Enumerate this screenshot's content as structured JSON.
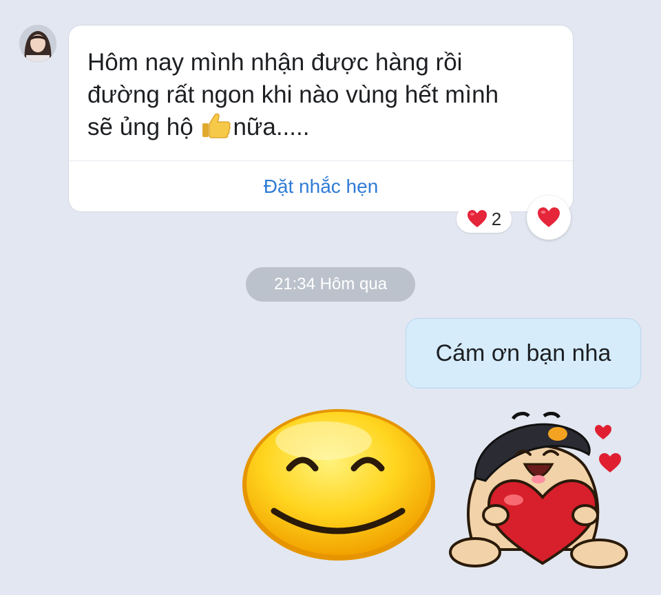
{
  "chat": {
    "incoming": {
      "avatar_icon": "user-avatar",
      "text_before_emoji": "Hôm nay mình nhận được hàng rồi\nđường rất ngon khi nào vùng hết mình\nsẽ ủng hộ ",
      "emoji": "thumbs-up",
      "text_after_emoji": "nữa.....",
      "action_label": "Đặt nhắc hẹn",
      "reaction": {
        "icon": "heart",
        "count": "2"
      }
    },
    "timestamp": "21:34 Hôm qua",
    "outgoing": {
      "text": "Cám ơn bạn nha"
    },
    "stickers": [
      {
        "icon": "smiley-face-sticker"
      },
      {
        "icon": "character-hugging-heart-sticker"
      }
    ]
  },
  "colors": {
    "background": "#e2e7f1",
    "incoming_bubble": "#ffffff",
    "outgoing_bubble": "#d6ecfb",
    "link": "#2f7bd6",
    "timestamp_pill": "#bcc2cc",
    "heart": "#e5253a"
  }
}
